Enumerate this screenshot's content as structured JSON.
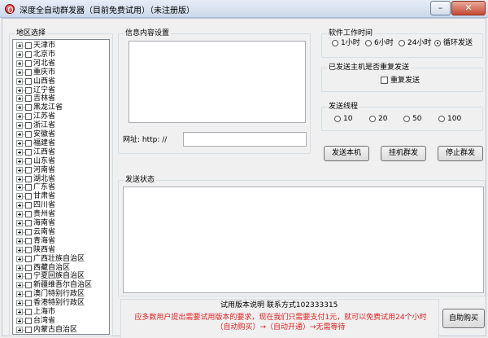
{
  "window": {
    "title": "深度全自动群发器（目前免费试用）（未注册版）",
    "minimize_glyph": "–",
    "close_glyph": "✕"
  },
  "region": {
    "group_title": "地区选择",
    "items": [
      "天津市",
      "北京市",
      "河北省",
      "重庆市",
      "山西省",
      "辽宁省",
      "吉林省",
      "黑龙江省",
      "江苏省",
      "浙江省",
      "安徽省",
      "福建省",
      "江西省",
      "山东省",
      "河南省",
      "湖北省",
      "广东省",
      "甘肃省",
      "四川省",
      "贵州省",
      "海南省",
      "云南省",
      "青海省",
      "陕西省",
      "广西壮族自治区",
      "西藏自治区",
      "宁夏回族自治区",
      "新疆维吾尔自治区",
      "澳门特别行政区",
      "香港特别行政区",
      "上海市",
      "台湾省",
      "内蒙古自治区"
    ]
  },
  "content": {
    "group_title": "信息内容设置",
    "url_label": "网址: http: //",
    "url_value": ""
  },
  "work_time": {
    "group_title": "软件工作时间",
    "options": [
      "1小时",
      "6小时",
      "24小时",
      "循环发送"
    ],
    "selected": "循环发送"
  },
  "repeat": {
    "group_title": "已发送主机是否重复发送",
    "checkbox_label": "重复发送",
    "checked": false
  },
  "threads": {
    "group_title": "发送线程",
    "options": [
      "10",
      "20",
      "50",
      "100"
    ],
    "selected": ""
  },
  "buttons": {
    "send_local": "发送本机",
    "hang_send": "挂机群发",
    "stop_send": "停止群发",
    "auto_buy": "自助购买"
  },
  "status": {
    "group_title": "发送状态"
  },
  "footer": {
    "title": "试用版本说明      联系方式102333315",
    "line1": "应多数用户提出需要试用版本的要求，现在我们只需要支付1元，就可以免费试用24个小时",
    "line2": "（自动购买）→（自动开通）→无需等待"
  },
  "colors": {
    "notice_text": "#e02020",
    "titlebar": "#cbd9ea"
  }
}
